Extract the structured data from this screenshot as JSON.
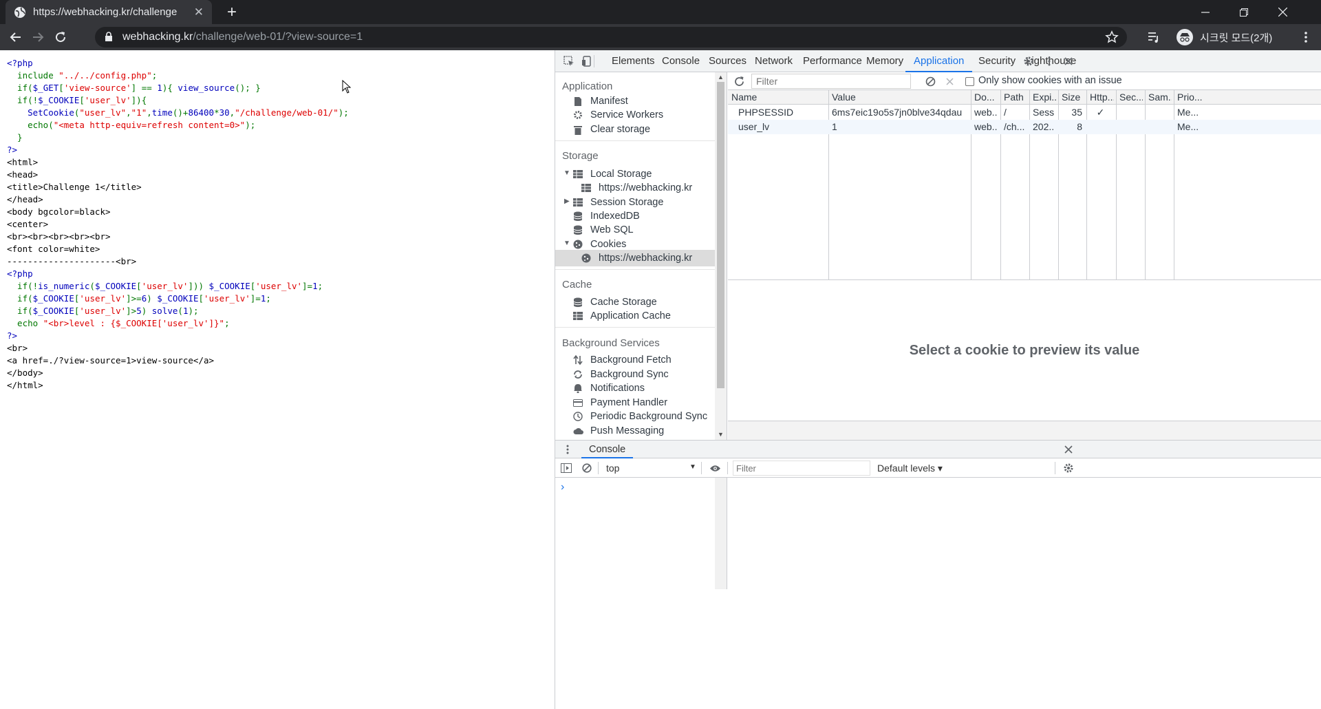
{
  "browser": {
    "tab_title": "https://webhacking.kr/challenge",
    "tab_close": "✕",
    "new_tab": "+",
    "url_host": "webhacking.kr",
    "url_path": "/challenge/web-01/?view-source=1",
    "incognito_label": "시크릿 모드(2개)"
  },
  "source_lines": [
    {
      "t": "<?php",
      "c": "php"
    },
    {
      "t": "  include \"../../config.php\";",
      "c": "mix1"
    },
    {
      "t": "  if($_GET['view-source'] == 1){ view_source(); }",
      "c": "mix2"
    },
    {
      "t": "  if(!$_COOKIE['user_lv']){",
      "c": "mix3"
    },
    {
      "t": "    SetCookie(\"user_lv\",\"1\",time()+86400*30,\"/challenge/web-01/\");",
      "c": "mix4"
    },
    {
      "t": "    echo(\"<meta http-equiv=refresh content=0>\");",
      "c": "mix5"
    },
    {
      "t": "  }",
      "c": "kw"
    },
    {
      "t": "?>",
      "c": "php"
    },
    {
      "t": "<html>",
      "c": "plain"
    },
    {
      "t": "<head>",
      "c": "plain"
    },
    {
      "t": "<title>Challenge 1</title>",
      "c": "plain"
    },
    {
      "t": "</head>",
      "c": "plain"
    },
    {
      "t": "<body bgcolor=black>",
      "c": "plain"
    },
    {
      "t": "<center>",
      "c": "plain"
    },
    {
      "t": "<br><br><br><br><br>",
      "c": "plain"
    },
    {
      "t": "<font color=white>",
      "c": "plain"
    },
    {
      "t": "---------------------<br>",
      "c": "plain"
    },
    {
      "t": "<?php",
      "c": "php"
    },
    {
      "t": "  if(!is_numeric($_COOKIE['user_lv'])) $_COOKIE['user_lv']=1;",
      "c": "mix6"
    },
    {
      "t": "  if($_COOKIE['user_lv']>=6) $_COOKIE['user_lv']=1;",
      "c": "mix7"
    },
    {
      "t": "  if($_COOKIE['user_lv']>5) solve(1);",
      "c": "mix8"
    },
    {
      "t": "  echo \"<br>level : {$_COOKIE['user_lv']}\";",
      "c": "mix9"
    },
    {
      "t": "?>",
      "c": "php"
    },
    {
      "t": "<br>",
      "c": "plain"
    },
    {
      "t": "<a href=./?view-source=1>view-source</a>",
      "c": "plain"
    },
    {
      "t": "</body>",
      "c": "plain"
    },
    {
      "t": "</html>",
      "c": "plain"
    }
  ],
  "devtools": {
    "tabs": [
      "Elements",
      "Console",
      "Sources",
      "Network",
      "Performance",
      "Memory",
      "Application",
      "Security",
      "Lighthouse"
    ],
    "active_tab": "Application",
    "sidebar": {
      "application_header": "Application",
      "manifest": "Manifest",
      "service_workers": "Service Workers",
      "clear_storage": "Clear storage",
      "storage_header": "Storage",
      "local_storage": "Local Storage",
      "local_storage_origin": "https://webhacking.kr",
      "session_storage": "Session Storage",
      "indexeddb": "IndexedDB",
      "web_sql": "Web SQL",
      "cookies": "Cookies",
      "cookies_origin": "https://webhacking.kr",
      "cache_header": "Cache",
      "cache_storage": "Cache Storage",
      "application_cache": "Application Cache",
      "bg_header": "Background Services",
      "background_fetch": "Background Fetch",
      "background_sync": "Background Sync",
      "notifications": "Notifications",
      "payment_handler": "Payment Handler",
      "periodic_bg_sync": "Periodic Background Sync",
      "push_messaging": "Push Messaging"
    },
    "cookies": {
      "filter_placeholder": "Filter",
      "only_issue_label": "Only show cookies with an issue",
      "columns": [
        "Name",
        "Value",
        "Do...",
        "Path",
        "Expi...",
        "Size",
        "Http...",
        "Sec...",
        "Sam...",
        "Prio..."
      ],
      "rows": [
        {
          "name": "PHPSESSID",
          "value": "6ms7eic19o5s7jn0blve34qdau",
          "domain": "web...",
          "path": "/",
          "expires": "Sess...",
          "size": "35",
          "http": "✓",
          "secure": "",
          "samesite": "",
          "priority": "Me..."
        },
        {
          "name": "user_lv",
          "value": "1",
          "domain": "web...",
          "path": "/ch...",
          "expires": "202...",
          "size": "8",
          "http": "",
          "secure": "",
          "samesite": "",
          "priority": "Me..."
        }
      ],
      "preview_message": "Select a cookie to preview its value"
    },
    "console": {
      "drawer_tab": "Console",
      "context": "top",
      "filter_placeholder": "Filter",
      "levels": "Default levels ▾",
      "prompt": "›"
    }
  }
}
